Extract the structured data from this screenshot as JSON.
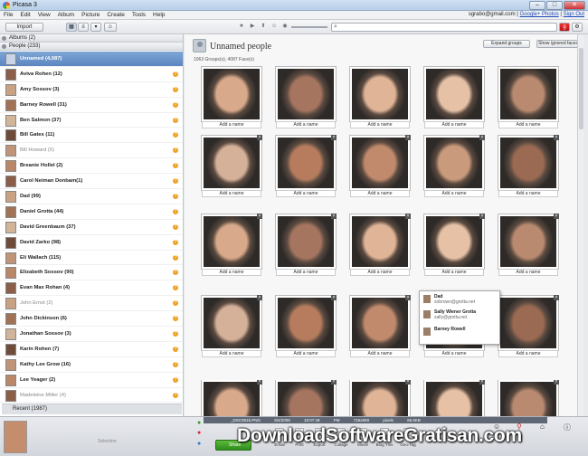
{
  "window": {
    "title": "Picasa 3",
    "buttons": [
      "–",
      "□",
      "✕"
    ]
  },
  "menu": {
    "items": [
      "File",
      "Edit",
      "View",
      "Album",
      "Picture",
      "Create",
      "Tools",
      "Help"
    ],
    "account_email": "sgrabo@gmail.com",
    "google_photos": "Google+ Photos",
    "sign_out": "Sign Out"
  },
  "toolbar": {
    "import_label": "Import",
    "search_placeholder": ""
  },
  "left": {
    "albums_header": "Albums (2)",
    "people_header": "People (233)",
    "people": [
      {
        "name": "Unnamed (4,087)",
        "selected": true
      },
      {
        "name": "Aviva Rohen (12)"
      },
      {
        "name": "Amy Sossov (3)"
      },
      {
        "name": "Barney Rowell (31)"
      },
      {
        "name": "Ben Salmon (37)"
      },
      {
        "name": "Bill Gates (11)"
      },
      {
        "name": "Bill Howard (5)",
        "faint": true
      },
      {
        "name": "Breanie Hollel (2)"
      },
      {
        "name": "Carol Neiman Donbam(1)"
      },
      {
        "name": "Dad (99)"
      },
      {
        "name": "Daniel Grotta (44)"
      },
      {
        "name": "David Greenbaum (37)"
      },
      {
        "name": "David Zarko (98)"
      },
      {
        "name": "Eli Wallach (115)"
      },
      {
        "name": "Elizabeth Sossov (90)"
      },
      {
        "name": "Evan Max Rohan (4)"
      },
      {
        "name": "John Ernst (2)",
        "faint": true
      },
      {
        "name": "John Dickinson (6)"
      },
      {
        "name": "Jonathan Sossov (3)"
      },
      {
        "name": "Karin Rohen (7)"
      },
      {
        "name": "Kathy Lee Grow (16)"
      },
      {
        "name": "Lee Yeager (2)"
      },
      {
        "name": "Madeleine Miller (4)",
        "faint": true
      }
    ],
    "others_header": "Recent (1987)"
  },
  "main": {
    "title": "Unnamed people",
    "subtitle": "1063 Groups(s), 4087 Face(s)",
    "expand_button": "Expand groups",
    "show_ignored_button": "Show ignored faces",
    "add_name": "Add a name"
  },
  "popup": {
    "items": [
      {
        "name": "Dad",
        "email": "sobrown@grotta.net"
      },
      {
        "name": "Sally Wiener Grotta",
        "email": "sally@grotta.net"
      },
      {
        "name": "Barney Rowell",
        "email": ""
      }
    ]
  },
  "bottom": {
    "tray_label": "Selection",
    "status": "_DSC0815.PNG 9/4/2008 10:07:49 PM 726x900 pixels 65.6KB",
    "share_button": "Share",
    "actions": [
      "Email",
      "Print",
      "Export",
      "Collage",
      "Movie",
      "Blog This",
      "Geo-Tag"
    ]
  },
  "watermark": "DownloadSoftwareGratisan.com",
  "colors": {
    "selection": "#5b86c0",
    "share": "#3a9a28",
    "warning_dot": "#f0a020"
  }
}
